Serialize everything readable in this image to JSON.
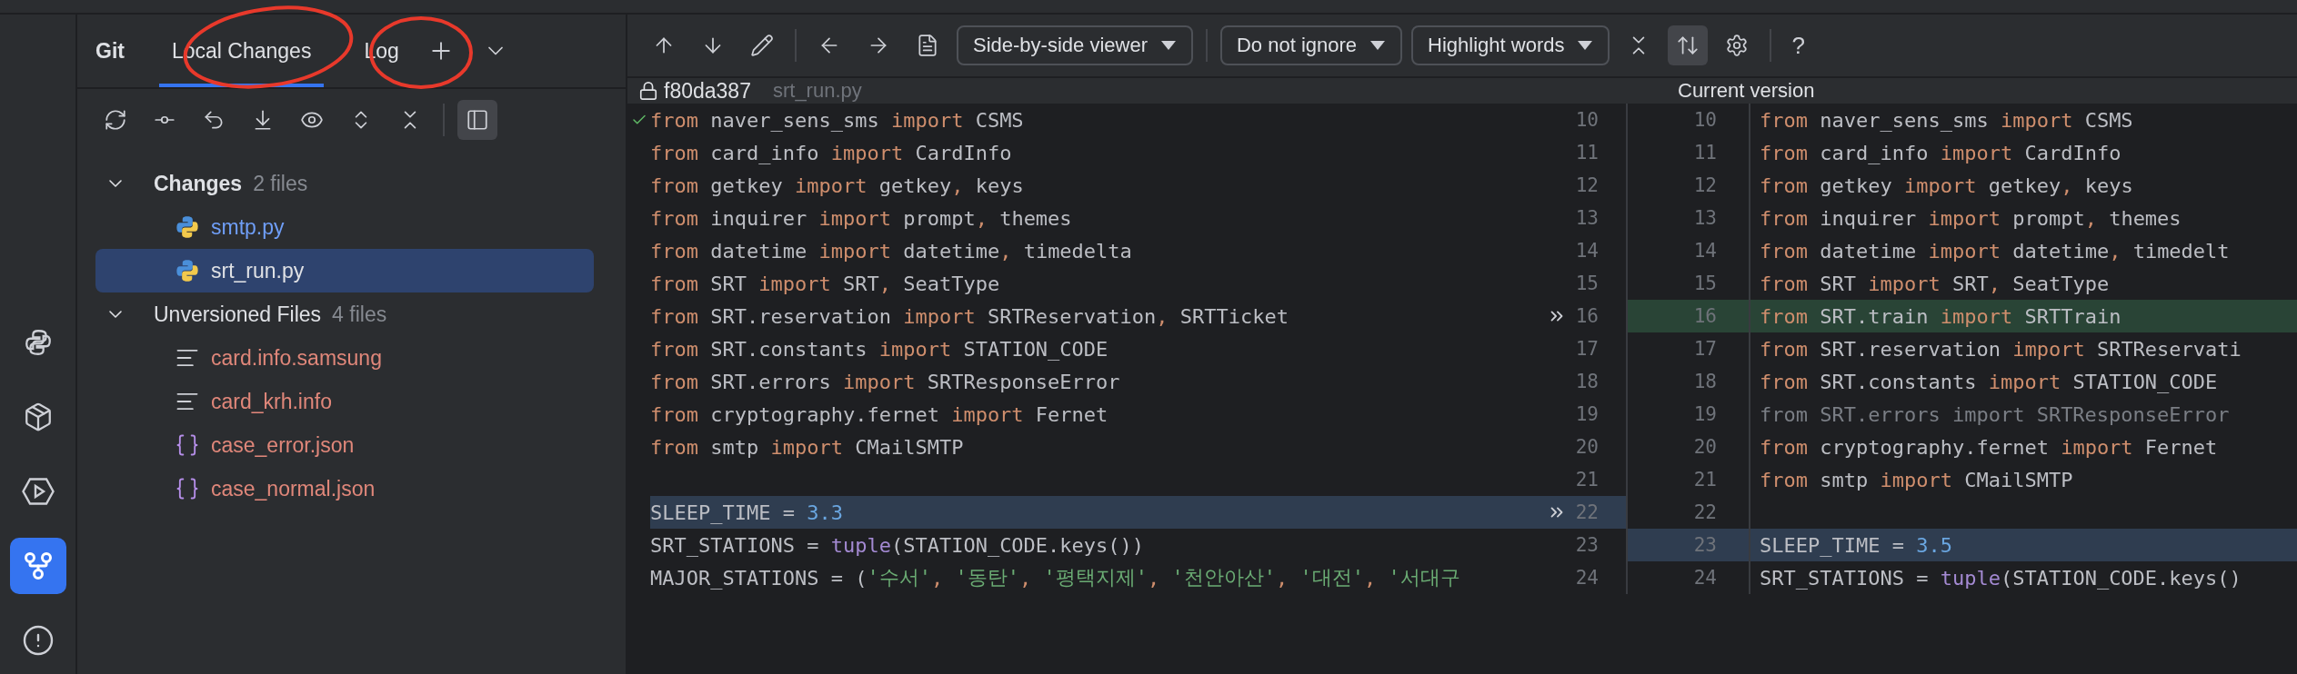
{
  "sidebar": {
    "items": [
      {
        "selected": false
      },
      {
        "selected": false
      },
      {
        "selected": false
      },
      {
        "selected": true
      },
      {
        "selected": false
      }
    ]
  },
  "tool_window": {
    "title": "Git",
    "tabs": [
      {
        "label": "Local Changes",
        "selected": true
      },
      {
        "label": "Log",
        "selected": false
      }
    ]
  },
  "changes_toolbar": {
    "preview_selected": true
  },
  "tree": [
    {
      "label": "Changes",
      "count": "2 files",
      "expanded": true,
      "children": [
        {
          "label": "smtp.py",
          "kind": "python",
          "color": "#6f9ef7",
          "selected": false
        },
        {
          "label": "srt_run.py",
          "kind": "python",
          "color": "#dfe1e5",
          "selected": true
        }
      ]
    },
    {
      "label": "Unversioned Files",
      "count": "4 files",
      "expanded": true,
      "children": [
        {
          "label": "card.info.samsung",
          "kind": "text",
          "color": "#e0877a",
          "selected": false
        },
        {
          "label": "card_krh.info",
          "kind": "text",
          "color": "#e0877a",
          "selected": false
        },
        {
          "label": "case_error.json",
          "kind": "json",
          "color": "#e0877a",
          "selected": false
        },
        {
          "label": "case_normal.json",
          "kind": "json",
          "color": "#e0877a",
          "selected": false
        }
      ]
    }
  ],
  "diff_toolbar": {
    "viewer": "Side-by-side viewer",
    "ignore": "Do not ignore",
    "highlight": "Highlight words",
    "sync_scroll_selected": true,
    "help": "?"
  },
  "diff": {
    "left_header": {
      "revision": "f80da387",
      "file": "srt_run.py"
    },
    "right_header": "Current version",
    "rows": [
      {
        "left_number": "10",
        "right_number": "10",
        "apply": false,
        "left_changed": false,
        "right_inserted": false,
        "right_changed": false,
        "left": [
          {
            "kind": "kw",
            "text": "from"
          },
          {
            "kind": "id",
            "text": " naver_sens_sms "
          },
          {
            "kind": "kw",
            "text": "import"
          },
          {
            "kind": "id",
            "text": " CSMS"
          }
        ],
        "right": [
          {
            "kind": "kw",
            "text": "from"
          },
          {
            "kind": "id",
            "text": " naver_sens_sms "
          },
          {
            "kind": "kw",
            "text": "import"
          },
          {
            "kind": "id",
            "text": " CSMS"
          }
        ]
      },
      {
        "left_number": "11",
        "right_number": "11",
        "apply": false,
        "left_changed": false,
        "right_inserted": false,
        "right_changed": false,
        "left": [
          {
            "kind": "kw",
            "text": "from"
          },
          {
            "kind": "id",
            "text": " card_info "
          },
          {
            "kind": "kw",
            "text": "import"
          },
          {
            "kind": "id",
            "text": " CardInfo"
          }
        ],
        "right": [
          {
            "kind": "kw",
            "text": "from"
          },
          {
            "kind": "id",
            "text": " card_info "
          },
          {
            "kind": "kw",
            "text": "import"
          },
          {
            "kind": "id",
            "text": " CardInfo"
          }
        ]
      },
      {
        "left_number": "12",
        "right_number": "12",
        "apply": false,
        "left_changed": false,
        "right_inserted": false,
        "right_changed": false,
        "left": [
          {
            "kind": "kw",
            "text": "from"
          },
          {
            "kind": "id",
            "text": " getkey "
          },
          {
            "kind": "kw",
            "text": "import"
          },
          {
            "kind": "id",
            "text": " getkey"
          },
          {
            "kind": "kw",
            "text": ","
          },
          {
            "kind": "id",
            "text": " keys"
          }
        ],
        "right": [
          {
            "kind": "kw",
            "text": "from"
          },
          {
            "kind": "id",
            "text": " getkey "
          },
          {
            "kind": "kw",
            "text": "import"
          },
          {
            "kind": "id",
            "text": " getkey"
          },
          {
            "kind": "kw",
            "text": ","
          },
          {
            "kind": "id",
            "text": " keys"
          }
        ]
      },
      {
        "left_number": "13",
        "right_number": "13",
        "apply": false,
        "left_changed": false,
        "right_inserted": false,
        "right_changed": false,
        "left": [
          {
            "kind": "kw",
            "text": "from"
          },
          {
            "kind": "id",
            "text": " inquirer "
          },
          {
            "kind": "kw",
            "text": "import"
          },
          {
            "kind": "id",
            "text": " prompt"
          },
          {
            "kind": "kw",
            "text": ","
          },
          {
            "kind": "id",
            "text": " themes"
          }
        ],
        "right": [
          {
            "kind": "kw",
            "text": "from"
          },
          {
            "kind": "id",
            "text": " inquirer "
          },
          {
            "kind": "kw",
            "text": "import"
          },
          {
            "kind": "id",
            "text": " prompt"
          },
          {
            "kind": "kw",
            "text": ","
          },
          {
            "kind": "id",
            "text": " themes"
          }
        ]
      },
      {
        "left_number": "14",
        "right_number": "14",
        "apply": false,
        "left_changed": false,
        "right_inserted": false,
        "right_changed": false,
        "left": [
          {
            "kind": "kw",
            "text": "from"
          },
          {
            "kind": "id",
            "text": " datetime "
          },
          {
            "kind": "kw",
            "text": "import"
          },
          {
            "kind": "id",
            "text": " datetime"
          },
          {
            "kind": "kw",
            "text": ","
          },
          {
            "kind": "id",
            "text": " timedelta"
          }
        ],
        "right": [
          {
            "kind": "kw",
            "text": "from"
          },
          {
            "kind": "id",
            "text": " datetime "
          },
          {
            "kind": "kw",
            "text": "import"
          },
          {
            "kind": "id",
            "text": " datetime"
          },
          {
            "kind": "kw",
            "text": ","
          },
          {
            "kind": "id",
            "text": " timedelt"
          }
        ]
      },
      {
        "left_number": "15",
        "right_number": "15",
        "apply": false,
        "left_changed": false,
        "right_inserted": false,
        "right_changed": false,
        "left": [
          {
            "kind": "kw",
            "text": "from"
          },
          {
            "kind": "id",
            "text": " SRT "
          },
          {
            "kind": "kw",
            "text": "import"
          },
          {
            "kind": "id",
            "text": " SRT"
          },
          {
            "kind": "kw",
            "text": ","
          },
          {
            "kind": "id",
            "text": " SeatType"
          }
        ],
        "right": [
          {
            "kind": "kw",
            "text": "from"
          },
          {
            "kind": "id",
            "text": " SRT "
          },
          {
            "kind": "kw",
            "text": "import"
          },
          {
            "kind": "id",
            "text": " SRT"
          },
          {
            "kind": "kw",
            "text": ","
          },
          {
            "kind": "id",
            "text": " SeatType"
          }
        ]
      },
      {
        "left_number": "16",
        "right_number": "16",
        "apply": true,
        "left_changed": false,
        "right_inserted": true,
        "right_changed": false,
        "left": [
          {
            "kind": "kw",
            "text": "from"
          },
          {
            "kind": "id",
            "text": " SRT.reservation "
          },
          {
            "kind": "kw",
            "text": "import"
          },
          {
            "kind": "id",
            "text": " SRTReservation"
          },
          {
            "kind": "kw",
            "text": ","
          },
          {
            "kind": "id",
            "text": " SRTTicket"
          }
        ],
        "right": [
          {
            "kind": "kw",
            "text": "from"
          },
          {
            "kind": "id",
            "text": " SRT.train "
          },
          {
            "kind": "kw",
            "text": "import"
          },
          {
            "kind": "id",
            "text": " SRTTrain"
          }
        ]
      },
      {
        "left_number": "17",
        "right_number": "17",
        "apply": false,
        "left_changed": false,
        "right_inserted": false,
        "right_changed": false,
        "left": [
          {
            "kind": "kw",
            "text": "from"
          },
          {
            "kind": "id",
            "text": " SRT.constants "
          },
          {
            "kind": "kw",
            "text": "import"
          },
          {
            "kind": "id",
            "text": " STATION_CODE"
          }
        ],
        "right": [
          {
            "kind": "kw",
            "text": "from"
          },
          {
            "kind": "id",
            "text": " SRT.reservation "
          },
          {
            "kind": "kw",
            "text": "import"
          },
          {
            "kind": "id",
            "text": " SRTReservati"
          }
        ]
      },
      {
        "left_number": "18",
        "right_number": "18",
        "apply": false,
        "left_changed": false,
        "right_inserted": false,
        "right_changed": false,
        "left": [
          {
            "kind": "kw",
            "text": "from"
          },
          {
            "kind": "id",
            "text": " SRT.errors "
          },
          {
            "kind": "kw",
            "text": "import"
          },
          {
            "kind": "id",
            "text": " SRTResponseError"
          }
        ],
        "right": [
          {
            "kind": "kw",
            "text": "from"
          },
          {
            "kind": "id",
            "text": " SRT.constants "
          },
          {
            "kind": "kw",
            "text": "import"
          },
          {
            "kind": "id",
            "text": " STATION_CODE"
          }
        ]
      },
      {
        "left_number": "19",
        "right_number": "19",
        "apply": false,
        "left_changed": false,
        "right_inserted": false,
        "right_changed": false,
        "left": [
          {
            "kind": "kw",
            "text": "from"
          },
          {
            "kind": "id",
            "text": " cryptography.fernet "
          },
          {
            "kind": "kw",
            "text": "import"
          },
          {
            "kind": "id",
            "text": " Fernet"
          }
        ],
        "right": [
          {
            "kind": "dim",
            "text": "from SRT.errors import SRTResponseError"
          }
        ]
      },
      {
        "left_number": "20",
        "right_number": "20",
        "apply": false,
        "left_changed": false,
        "right_inserted": false,
        "right_changed": false,
        "left": [
          {
            "kind": "kw",
            "text": "from"
          },
          {
            "kind": "id",
            "text": " smtp "
          },
          {
            "kind": "kw",
            "text": "import"
          },
          {
            "kind": "id",
            "text": " CMailSMTP"
          }
        ],
        "right": [
          {
            "kind": "kw",
            "text": "from"
          },
          {
            "kind": "id",
            "text": " cryptography.fernet "
          },
          {
            "kind": "kw",
            "text": "import"
          },
          {
            "kind": "id",
            "text": " Fernet"
          }
        ]
      },
      {
        "left_number": "21",
        "right_number": "21",
        "apply": false,
        "left_changed": false,
        "right_inserted": false,
        "right_changed": false,
        "left": [],
        "right": [
          {
            "kind": "kw",
            "text": "from"
          },
          {
            "kind": "id",
            "text": " smtp "
          },
          {
            "kind": "kw",
            "text": "import"
          },
          {
            "kind": "id",
            "text": " CMailSMTP"
          }
        ]
      },
      {
        "left_number": "22",
        "right_number": "22",
        "apply": true,
        "left_changed": true,
        "right_inserted": false,
        "right_changed": false,
        "left": [
          {
            "kind": "id",
            "text": "SLEEP_TIME = "
          },
          {
            "kind": "num",
            "text": "3.3"
          }
        ],
        "right": []
      },
      {
        "left_number": "23",
        "right_number": "23",
        "apply": false,
        "left_changed": false,
        "right_inserted": false,
        "right_changed": true,
        "left": [
          {
            "kind": "id",
            "text": "SRT_STATIONS = "
          },
          {
            "kind": "builtin",
            "text": "tuple"
          },
          {
            "kind": "id",
            "text": "(STATION_CODE.keys())"
          }
        ],
        "right": [
          {
            "kind": "id",
            "text": "SLEEP_TIME = "
          },
          {
            "kind": "num",
            "text": "3.5"
          }
        ]
      },
      {
        "left_number": "24",
        "right_number": "24",
        "apply": false,
        "left_changed": false,
        "right_inserted": false,
        "right_changed": false,
        "left": [
          {
            "kind": "id",
            "text": "MAJOR_STATIONS = ("
          },
          {
            "kind": "str",
            "text": "'수서'"
          },
          {
            "kind": "kw",
            "text": ", "
          },
          {
            "kind": "str",
            "text": "'동탄'"
          },
          {
            "kind": "kw",
            "text": ", "
          },
          {
            "kind": "str",
            "text": "'평택지제'"
          },
          {
            "kind": "kw",
            "text": ", "
          },
          {
            "kind": "str",
            "text": "'천안아산'"
          },
          {
            "kind": "kw",
            "text": ", "
          },
          {
            "kind": "str",
            "text": "'대전'"
          },
          {
            "kind": "kw",
            "text": ", "
          },
          {
            "kind": "str",
            "text": "'서대구"
          }
        ],
        "right": [
          {
            "kind": "id",
            "text": "SRT_STATIONS = "
          },
          {
            "kind": "builtin",
            "text": "tuple"
          },
          {
            "kind": "id",
            "text": "(STATION_CODE.keys()"
          }
        ]
      }
    ]
  }
}
